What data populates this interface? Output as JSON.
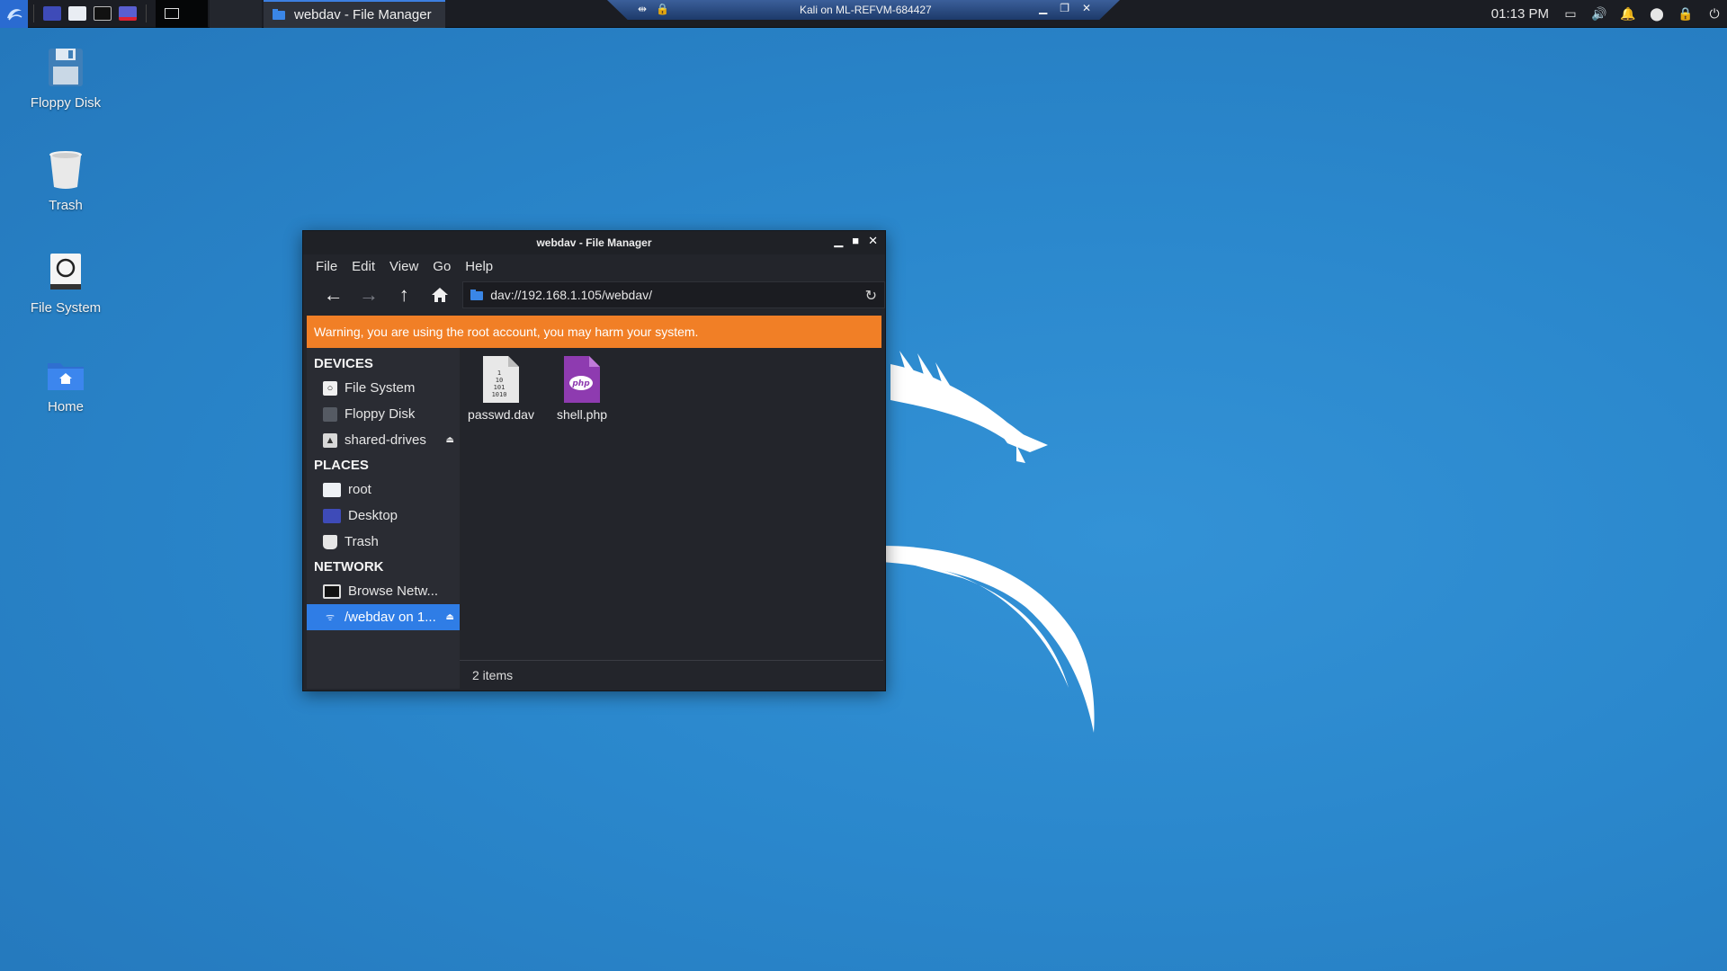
{
  "colors": {
    "desktop_bg": "#2a87cc",
    "panel_bg": "#1b1d23",
    "accent": "#2f7de6",
    "warning_bg": "#f17f26",
    "window_bg": "#23252b"
  },
  "panel": {
    "task_title": "webdav - File Manager",
    "remote_title": "Kali on ML-REFVM-684427",
    "clock": "01:13 PM",
    "launchers": [
      "kali-menu-icon",
      "desktop-icon",
      "file-manager-icon",
      "terminal-icon",
      "screenshot-icon"
    ],
    "tray_icons": [
      "display-icon",
      "volume-icon",
      "notification-bell-icon",
      "update-icon",
      "lock-icon",
      "power-icon"
    ]
  },
  "desktop": {
    "icons": [
      {
        "label": "Floppy Disk",
        "icon": "floppy-disk-icon"
      },
      {
        "label": "Trash",
        "icon": "trash-icon"
      },
      {
        "label": "File System",
        "icon": "file-system-icon"
      },
      {
        "label": "Home",
        "icon": "home-folder-icon"
      }
    ]
  },
  "window": {
    "title": "webdav - File Manager",
    "menu": [
      "File",
      "Edit",
      "View",
      "Go",
      "Help"
    ],
    "address": "dav://192.168.1.105/webdav/",
    "warning": "Warning, you are using the root account, you may harm your system.",
    "sidebar": {
      "devices_header": "DEVICES",
      "devices": [
        "File System",
        "Floppy Disk",
        "shared-drives"
      ],
      "places_header": "PLACES",
      "places": [
        "root",
        "Desktop",
        "Trash"
      ],
      "network_header": "NETWORK",
      "network": [
        "Browse Netw...",
        "/webdav on 1..."
      ]
    },
    "files": [
      {
        "name": "passwd.dav",
        "icon": "binary-file-icon",
        "glyph": "1\n10\n101\n1010"
      },
      {
        "name": "shell.php",
        "icon": "php-file-icon",
        "glyph": "php"
      }
    ],
    "status": "2 items"
  }
}
